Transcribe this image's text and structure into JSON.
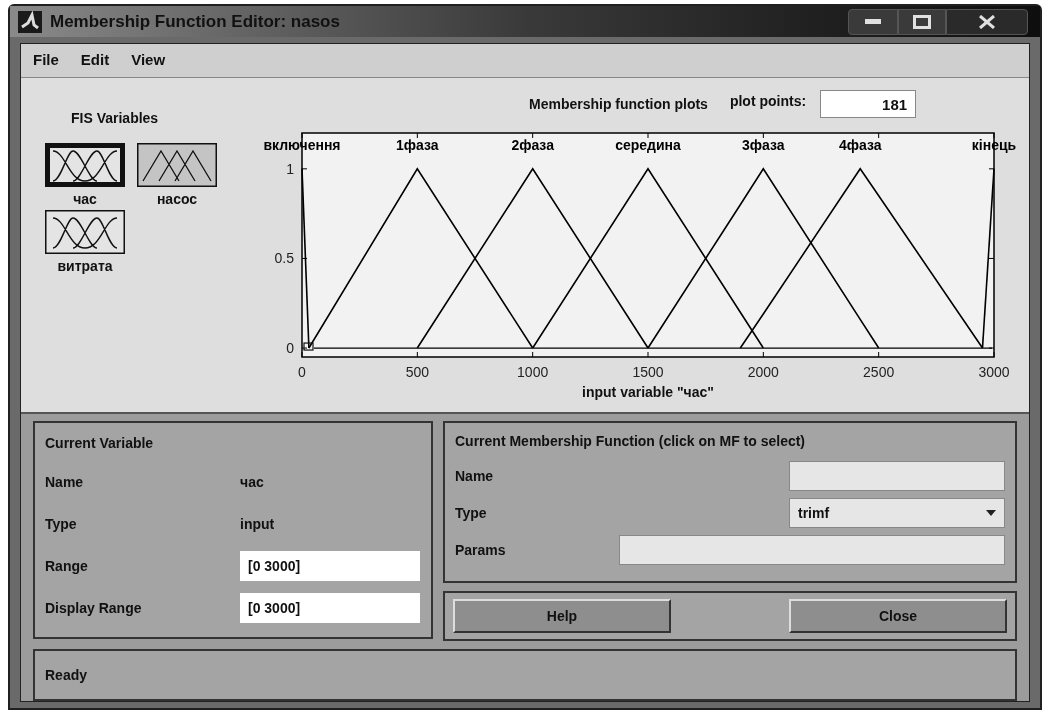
{
  "window": {
    "title": "Membership Function Editor: nasos"
  },
  "menu": [
    "File",
    "Edit",
    "View"
  ],
  "fis_variables": {
    "title": "FIS Variables",
    "items": [
      {
        "label": "час",
        "kind": "input",
        "selected": true
      },
      {
        "label": "насос",
        "kind": "output",
        "selected": false
      },
      {
        "label": "витрата",
        "kind": "input",
        "selected": false
      }
    ]
  },
  "plot": {
    "plot_points_label": "plot points:",
    "plot_points": "181",
    "chart_data": {
      "type": "line",
      "title": "Membership function plots",
      "xlabel": "input variable \"час\"",
      "x": [
        0,
        30,
        500,
        1000,
        1500,
        1900,
        2000,
        2420,
        2500,
        2950,
        3000
      ],
      "series": [
        {
          "name": "включення",
          "color": "#000000",
          "values": [
            1,
            0,
            null,
            null,
            null,
            null,
            null,
            null,
            null,
            null,
            null
          ]
        },
        {
          "name": "1фаза",
          "color": "#000000",
          "values": [
            null,
            0,
            1,
            0,
            null,
            null,
            null,
            null,
            null,
            null,
            null
          ]
        },
        {
          "name": "2фаза",
          "color": "#000000",
          "values": [
            null,
            null,
            0,
            1,
            0,
            null,
            null,
            null,
            null,
            null,
            null
          ]
        },
        {
          "name": "середина",
          "color": "#000000",
          "values": [
            null,
            null,
            null,
            0,
            1,
            0.2,
            0,
            null,
            null,
            null,
            null
          ]
        },
        {
          "name": "3фаза",
          "color": "#000000",
          "values": [
            null,
            null,
            null,
            null,
            0,
            0.8,
            1,
            0.16,
            0,
            null,
            null
          ]
        },
        {
          "name": "4фаза",
          "color": "#000000",
          "values": [
            null,
            null,
            null,
            null,
            null,
            0,
            0.19,
            1,
            0.85,
            0,
            null
          ]
        },
        {
          "name": "кінець",
          "color": "#000000",
          "values": [
            null,
            null,
            null,
            null,
            null,
            null,
            null,
            null,
            null,
            0,
            1
          ]
        }
      ],
      "legend": "top",
      "xlim": [
        0,
        3000
      ],
      "ylim": [
        -0.05,
        1.2
      ],
      "xticks": [
        0,
        500,
        1000,
        1500,
        2000,
        2500,
        3000
      ],
      "yticks": [
        0,
        0.5,
        1
      ]
    }
  },
  "current_variable": {
    "title": "Current Variable",
    "fields": [
      {
        "label": "Name",
        "kind": "text",
        "value": "час"
      },
      {
        "label": "Type",
        "kind": "text",
        "value": "input"
      },
      {
        "label": "Range",
        "kind": "input",
        "value": "[0 3000]"
      },
      {
        "label": "Display Range",
        "kind": "input",
        "value": "[0 3000]"
      }
    ]
  },
  "current_mf": {
    "title": "Current Membership Function (click on MF to select)",
    "fields": [
      {
        "label": "Name",
        "kind": "input"
      },
      {
        "label": "Type",
        "kind": "dropdown",
        "value": "trimf"
      },
      {
        "label": "Params",
        "kind": "wide_input"
      }
    ]
  },
  "buttons": [
    "Help",
    "Close"
  ],
  "status": "Ready"
}
